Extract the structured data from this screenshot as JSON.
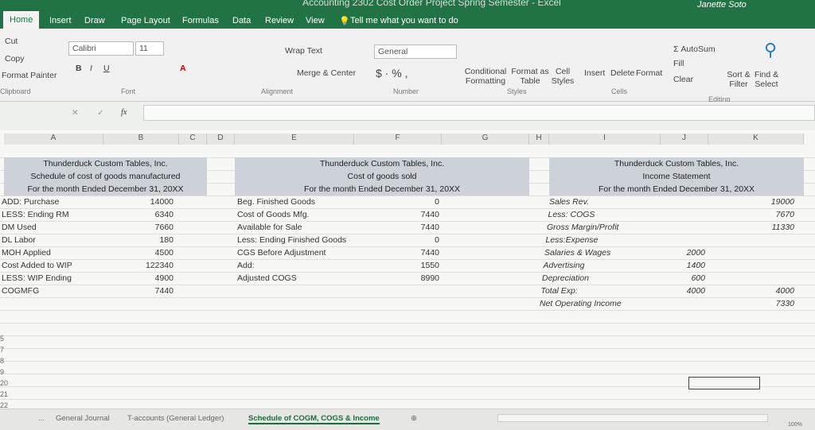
{
  "window": {
    "title": "Accounting 2302 Cost Order Project Spring Semester  -  Excel",
    "user": "Janette Soto"
  },
  "tabs": [
    "Home",
    "Insert",
    "Draw",
    "Page Layout",
    "Formulas",
    "Data",
    "Review",
    "View"
  ],
  "tell_me": "Tell me what you want to do",
  "ribbon": {
    "cut": "Cut",
    "copy": "Copy",
    "format_painter": "Format Painter",
    "clipboard": "Clipboard",
    "font_name": "Calibri",
    "font_size": "11",
    "font": "Font",
    "wrap_text": "Wrap Text",
    "merge_center": "Merge & Center",
    "alignment": "Alignment",
    "number_format": "General",
    "number": "Number",
    "conditional_formatting": "Conditional Formatting",
    "format_as_table": "Format as Table",
    "cell_styles": "Cell Styles",
    "styles": "Styles",
    "insert": "Insert",
    "delete": "Delete",
    "format": "Format",
    "cells": "Cells",
    "autosum": "AutoSum",
    "fill": "Fill",
    "clear": "Clear",
    "sort_filter": "Sort & Filter",
    "find_select": "Find & Select",
    "editing": "Editing",
    "fx": "fx"
  },
  "columns": [
    "A",
    "B",
    "C",
    "D",
    "E",
    "F",
    "G",
    "H",
    "I",
    "J",
    "K"
  ],
  "cogm": {
    "header": [
      "Thunderduck Custom Tables, Inc.",
      "Schedule of cost of goods manufactured",
      "For the month Ended December 31, 20XX"
    ],
    "rows": [
      [
        "ADD: Purchase",
        "14000"
      ],
      [
        "LESS: Ending RM",
        "6340"
      ],
      [
        "DM Used",
        "7660"
      ],
      [
        "DL Labor",
        "180"
      ],
      [
        "MOH Applied",
        "4500"
      ],
      [
        "Cost Added to WIP",
        "122340"
      ],
      [
        "LESS: WIP Ending",
        "4900"
      ],
      [
        "COGMFG",
        "7440"
      ]
    ]
  },
  "cogs": {
    "header": [
      "Thunderduck Custom Tables, Inc.",
      "Cost of goods sold",
      "For the month Ended December 31, 20XX"
    ],
    "rows": [
      [
        "Beg. Finished Goods",
        "0"
      ],
      [
        "Cost of Goods Mfg.",
        "7440"
      ],
      [
        "Available for Sale",
        "7440"
      ],
      [
        "Less: Ending Finished Goods",
        "0"
      ],
      [
        "CGS Before Adjustment",
        "7440"
      ],
      [
        "Add:",
        "1550"
      ],
      [
        "Adjusted COGS",
        "8990"
      ]
    ]
  },
  "income": {
    "header": [
      "Thunderduck Custom Tables, Inc.",
      "Income Statement",
      "For the month Ended December 31, 20XX"
    ],
    "rows": [
      [
        "Sales Rev.",
        "",
        "19000"
      ],
      [
        "Less: COGS",
        "",
        "7670"
      ],
      [
        "Gross Margin/Profit",
        "",
        "11330"
      ],
      [
        "Less:Expense",
        "",
        ""
      ],
      [
        "Salaries & Wages",
        "2000",
        ""
      ],
      [
        "Advertising",
        "1400",
        ""
      ],
      [
        "Depreciation",
        "600",
        ""
      ],
      [
        "Total Exp:",
        "4000",
        "4000"
      ],
      [
        "Net Operating Income",
        "",
        "7330"
      ]
    ]
  },
  "row_numbers": [
    "5",
    "7",
    "8",
    "9",
    "20",
    "21",
    "22"
  ],
  "sheets": [
    "...",
    "General Journal",
    "T-accounts (General Ledger)",
    "Schedule of COGM, COGS & Income"
  ],
  "active_sheet": "Schedule of COGM, COGS & Income",
  "zoom": "100%"
}
